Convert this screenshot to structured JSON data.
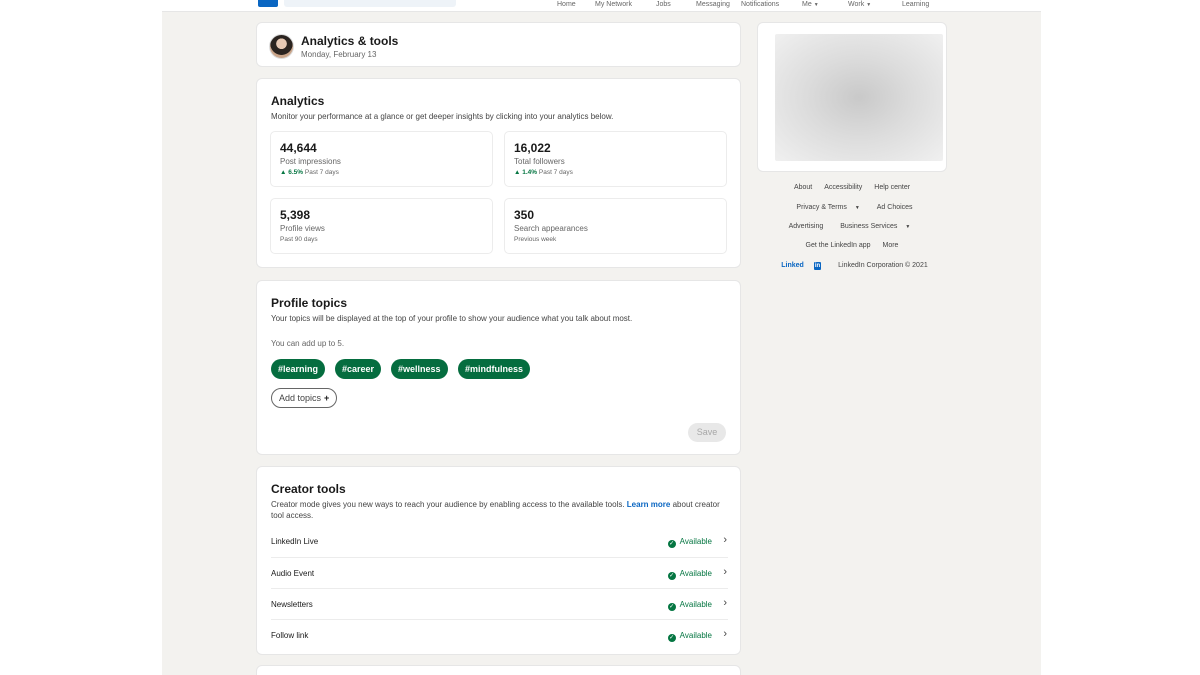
{
  "nav": {
    "items": [
      {
        "label": "Home"
      },
      {
        "label": "My Network"
      },
      {
        "label": "Jobs"
      },
      {
        "label": "Messaging"
      },
      {
        "label": "Notifications"
      },
      {
        "label": "Me"
      },
      {
        "label": "Work"
      },
      {
        "label": "Learning"
      }
    ],
    "accent": "#0a66c2"
  },
  "header": {
    "title": "Analytics & tools",
    "date": "Monday, February 13"
  },
  "analytics": {
    "title": "Analytics",
    "description": "Monitor your performance at a glance or get deeper insights by clicking into your analytics below.",
    "stats": [
      {
        "value": "44,644",
        "label": "Post impressions",
        "change": "▲ 6.5%",
        "period": "Past 7 days"
      },
      {
        "value": "16,022",
        "label": "Total followers",
        "change": "▲ 1.4%",
        "period": "Past 7 days"
      },
      {
        "value": "5,398",
        "label": "Profile views",
        "change": "",
        "period": "Past 90 days"
      },
      {
        "value": "350",
        "label": "Search appearances",
        "change": "",
        "period": "Previous week"
      }
    ]
  },
  "topics": {
    "title": "Profile topics",
    "description": "Your topics will be displayed at the top of your profile to show your audience what you talk about most.",
    "limit": "You can add up to 5.",
    "tags": [
      "#learning",
      "#career",
      "#wellness",
      "#mindfulness"
    ],
    "add_label": "Add topics",
    "add_icon": "+",
    "save_label": "Save",
    "tag_color": "#056d3f"
  },
  "creator": {
    "title": "Creator tools",
    "description": "Creator mode gives you new ways to reach your audience by enabling access to the available tools.",
    "learn_more": "Learn more",
    "description_tail": "about creator tool access.",
    "tools": [
      {
        "name": "LinkedIn Live",
        "status": "Available"
      },
      {
        "name": "Audio Event",
        "status": "Available"
      },
      {
        "name": "Newsletters",
        "status": "Available"
      },
      {
        "name": "Follow link",
        "status": "Available"
      }
    ],
    "status_color": "#057642"
  },
  "footer": {
    "links": [
      "About",
      "Accessibility",
      "Help center",
      "Privacy & Terms",
      "Ad Choices",
      "Advertising",
      "Business Services",
      "Get the LinkedIn app",
      "More"
    ],
    "brand_text": "Linked",
    "brand_in": "in",
    "copyright": "LinkedIn Corporation © 2021"
  }
}
